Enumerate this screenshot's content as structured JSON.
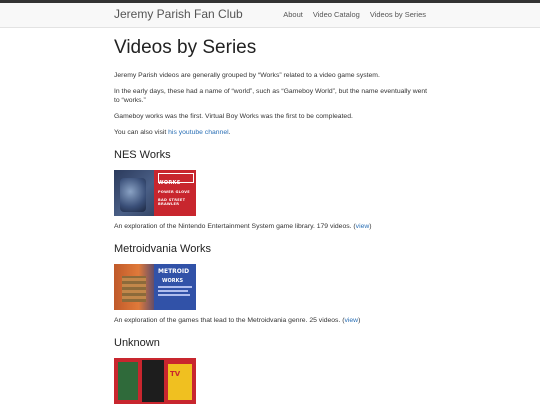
{
  "navbar": {
    "brand": "Jeremy Parish Fan Club",
    "links": [
      "About",
      "Video Catalog",
      "Videos by Series"
    ]
  },
  "page": {
    "title": "Videos by Series",
    "intro": [
      "Jeremy Parish videos are generally grouped by “Works” related to a video game system.",
      "In the early days, these had a name of “world”, such as “Gameboy World”, but the name eventually went to “works.”",
      "Gameboy works was the first. Virtual Boy Works was the first to be compleated."
    ],
    "visit_prefix": "You can also visit ",
    "visit_link": "his youtube channel",
    "visit_suffix": "."
  },
  "series": [
    {
      "name": "NES Works",
      "thumb_texts": [
        "WORKS",
        "POWER GLOVE",
        "BAD STREET",
        "BRAWLER"
      ],
      "description": "An exploration of the Nintendo Entertainment System game library. 179 videos. (",
      "view_label": "view",
      "desc_suffix": ")"
    },
    {
      "name": "Metroidvania Works",
      "thumb_texts": [
        "METROID",
        "WORKS"
      ],
      "description": "An exploration of the games that lead to the Metroidvania genre. 25 videos. (",
      "view_label": "view",
      "desc_suffix": ")"
    },
    {
      "name": "Unknown",
      "thumb_texts": [
        "TV"
      ]
    }
  ]
}
